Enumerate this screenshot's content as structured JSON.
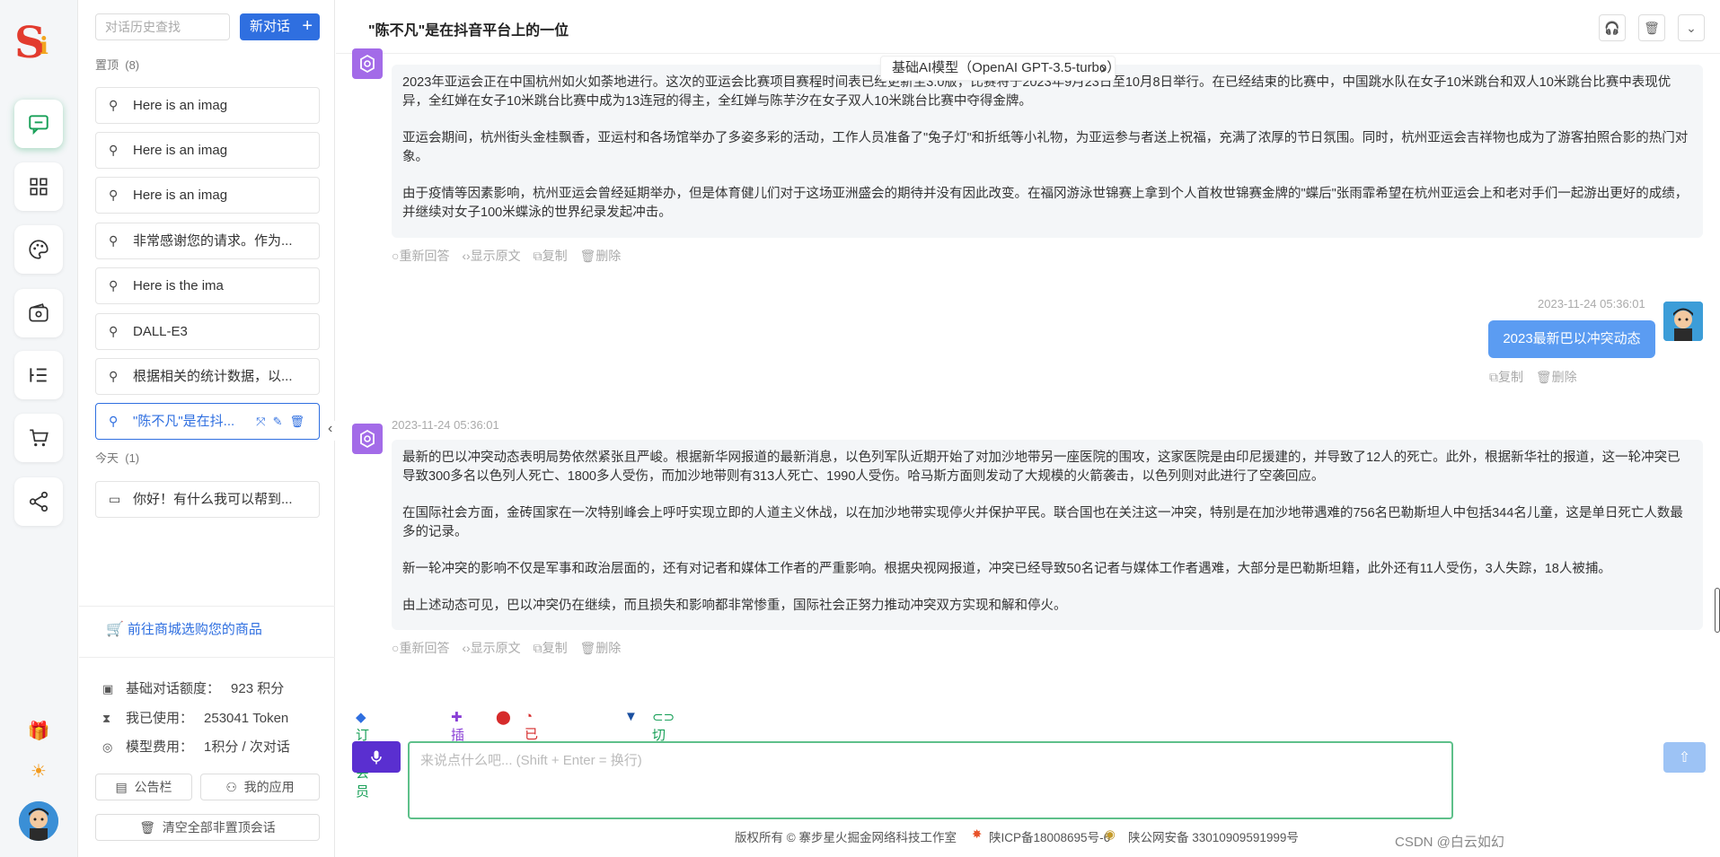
{
  "rail": {
    "items": [
      {
        "name": "chat"
      },
      {
        "name": "apps"
      },
      {
        "name": "palette"
      },
      {
        "name": "wallet"
      },
      {
        "name": "list"
      },
      {
        "name": "cart"
      },
      {
        "name": "share"
      }
    ],
    "bottom": [
      {
        "glyph": "🎁"
      },
      {
        "glyph": "☀"
      }
    ]
  },
  "sidebar": {
    "search_placeholder": "对话历史查找",
    "new_chat_label": "新对话",
    "pinned_label": "置顶",
    "pinned_count": "(8)",
    "pinned": [
      {
        "label": "Here is an imag"
      },
      {
        "label": "Here is an imag"
      },
      {
        "label": "Here is an imag"
      },
      {
        "label": "非常感谢您的请求。作为..."
      },
      {
        "label": "Here is the ima"
      },
      {
        "label": "DALL-E3"
      },
      {
        "label": "根据相关的统计数据，以..."
      },
      {
        "label": "\"陈不凡\"是在抖..."
      }
    ],
    "today_label": "今天",
    "today_count": "(1)",
    "today": [
      {
        "label": "你好！有什么我可以帮到..."
      }
    ],
    "shop_link": "前往商城选购您的商品",
    "stats": [
      {
        "label": "基础对话额度：",
        "value": "923 积分"
      },
      {
        "label": "我已使用：",
        "value": "253041 Token"
      },
      {
        "label": "模型费用：",
        "value": "1积分 / 次对话"
      }
    ],
    "notice_btn": "公告栏",
    "my_apps_btn": "我的应用",
    "clear_btn": "清空全部非置顶会话"
  },
  "header": {
    "title": "\"陈不凡\"是在抖音平台上的一位"
  },
  "model_bar": "基础AI模型（OpenAI GPT-3.5-turbo）",
  "messages": {
    "first_bot": [
      "2023年亚运会正在中国杭州如火如荼地进行。这次的亚运会比赛项目赛程时间表已经更新至3.0版，比赛将于2023年9月23日至10月8日举行。在已经结束的比赛中，中国跳水队在女子10米跳台和双人10米跳台比赛中表现优异，全红婵在女子10米跳台比赛中成为13连冠的得主，全红婵与陈芋汐在女子双人10米跳台比赛中夺得金牌。",
      "亚运会期间，杭州街头金桂飘香，亚运村和各场馆举办了多姿多彩的活动，工作人员准备了\"兔子灯\"和折纸等小礼物，为亚运参与者送上祝福，充满了浓厚的节日氛围。同时，杭州亚运会吉祥物也成为了游客拍照合影的热门对象。",
      "由于疫情等因素影响，杭州亚运会曾经延期举办，但是体育健儿们对于这场亚洲盛会的期待并没有因此改变。在福冈游泳世锦赛上拿到个人首枚世锦赛金牌的\"蝶后\"张雨霏希望在杭州亚运会上和老对手们一起游出更好的成绩，并继续对女子100米蝶泳的世界纪录发起冲击。"
    ],
    "bot_actions": [
      "重新回答",
      "显示原文",
      "复制",
      "删除"
    ],
    "user_ts": "2023-11-24 05:36:01",
    "user_text": "2023最新巴以冲突动态",
    "user_actions": [
      "复制",
      "删除"
    ],
    "second_ts": "2023-11-24 05:36:01",
    "second_bot": [
      "最新的巴以冲突动态表明局势依然紧张且严峻。根据新华网报道的最新消息，以色列军队近期开始了对加沙地带另一座医院的围攻，这家医院是由印尼援建的，并导致了12人的死亡。此外，根据新华社的报道，这一轮冲突已导致300多名以色列人死亡、1800多人受伤，而加沙地带则有313人死亡、1990人受伤。哈马斯方面则发动了大规模的火箭袭击，以色列则对此进行了空袭回应。",
      "在国际社会方面，金砖国家在一次特别峰会上呼吁实现立即的人道主义休战，以在加沙地带实现停火并保护平民。联合国也在关注这一冲突，特别是在加沙地带遇难的756名巴勒斯坦人中包括344名儿童，这是单日死亡人数最多的记录。",
      "新一轮冲突的影响不仅是军事和政治层面的，还有对记者和媒体工作者的严重影响。根据央视网报道，冲突已经导致50名记者与媒体工作者遇难，大部分是巴勒斯坦籍，此外还有11人受伤，3人失踪，18人被捕。",
      "由上述动态可见，巴以冲突仍在继续，而且损失和影响都非常惨重，国际社会正努力推动冲突双方实现和解和停火。"
    ]
  },
  "toolbar": {
    "subscribe": "订阅会员",
    "plugin": "插件",
    "memory": "已关闭记忆",
    "theme": "切换主题"
  },
  "input": {
    "placeholder": "来说点什么吧... (Shift + Enter = 换行)"
  },
  "footer": {
    "copyright": "版权所有 © 寨步星火掘金网络科技工作室",
    "icp": "陕ICP备18008695号-6",
    "police": "陕公网安备 33010909591999号"
  },
  "watermark": "CSDN @白云如幻",
  "colors": {
    "primary": "#2f6fe0",
    "accent_green": "#18a058",
    "bot_avatar": "#a36be8",
    "user_bubble": "#5b9cf2"
  }
}
